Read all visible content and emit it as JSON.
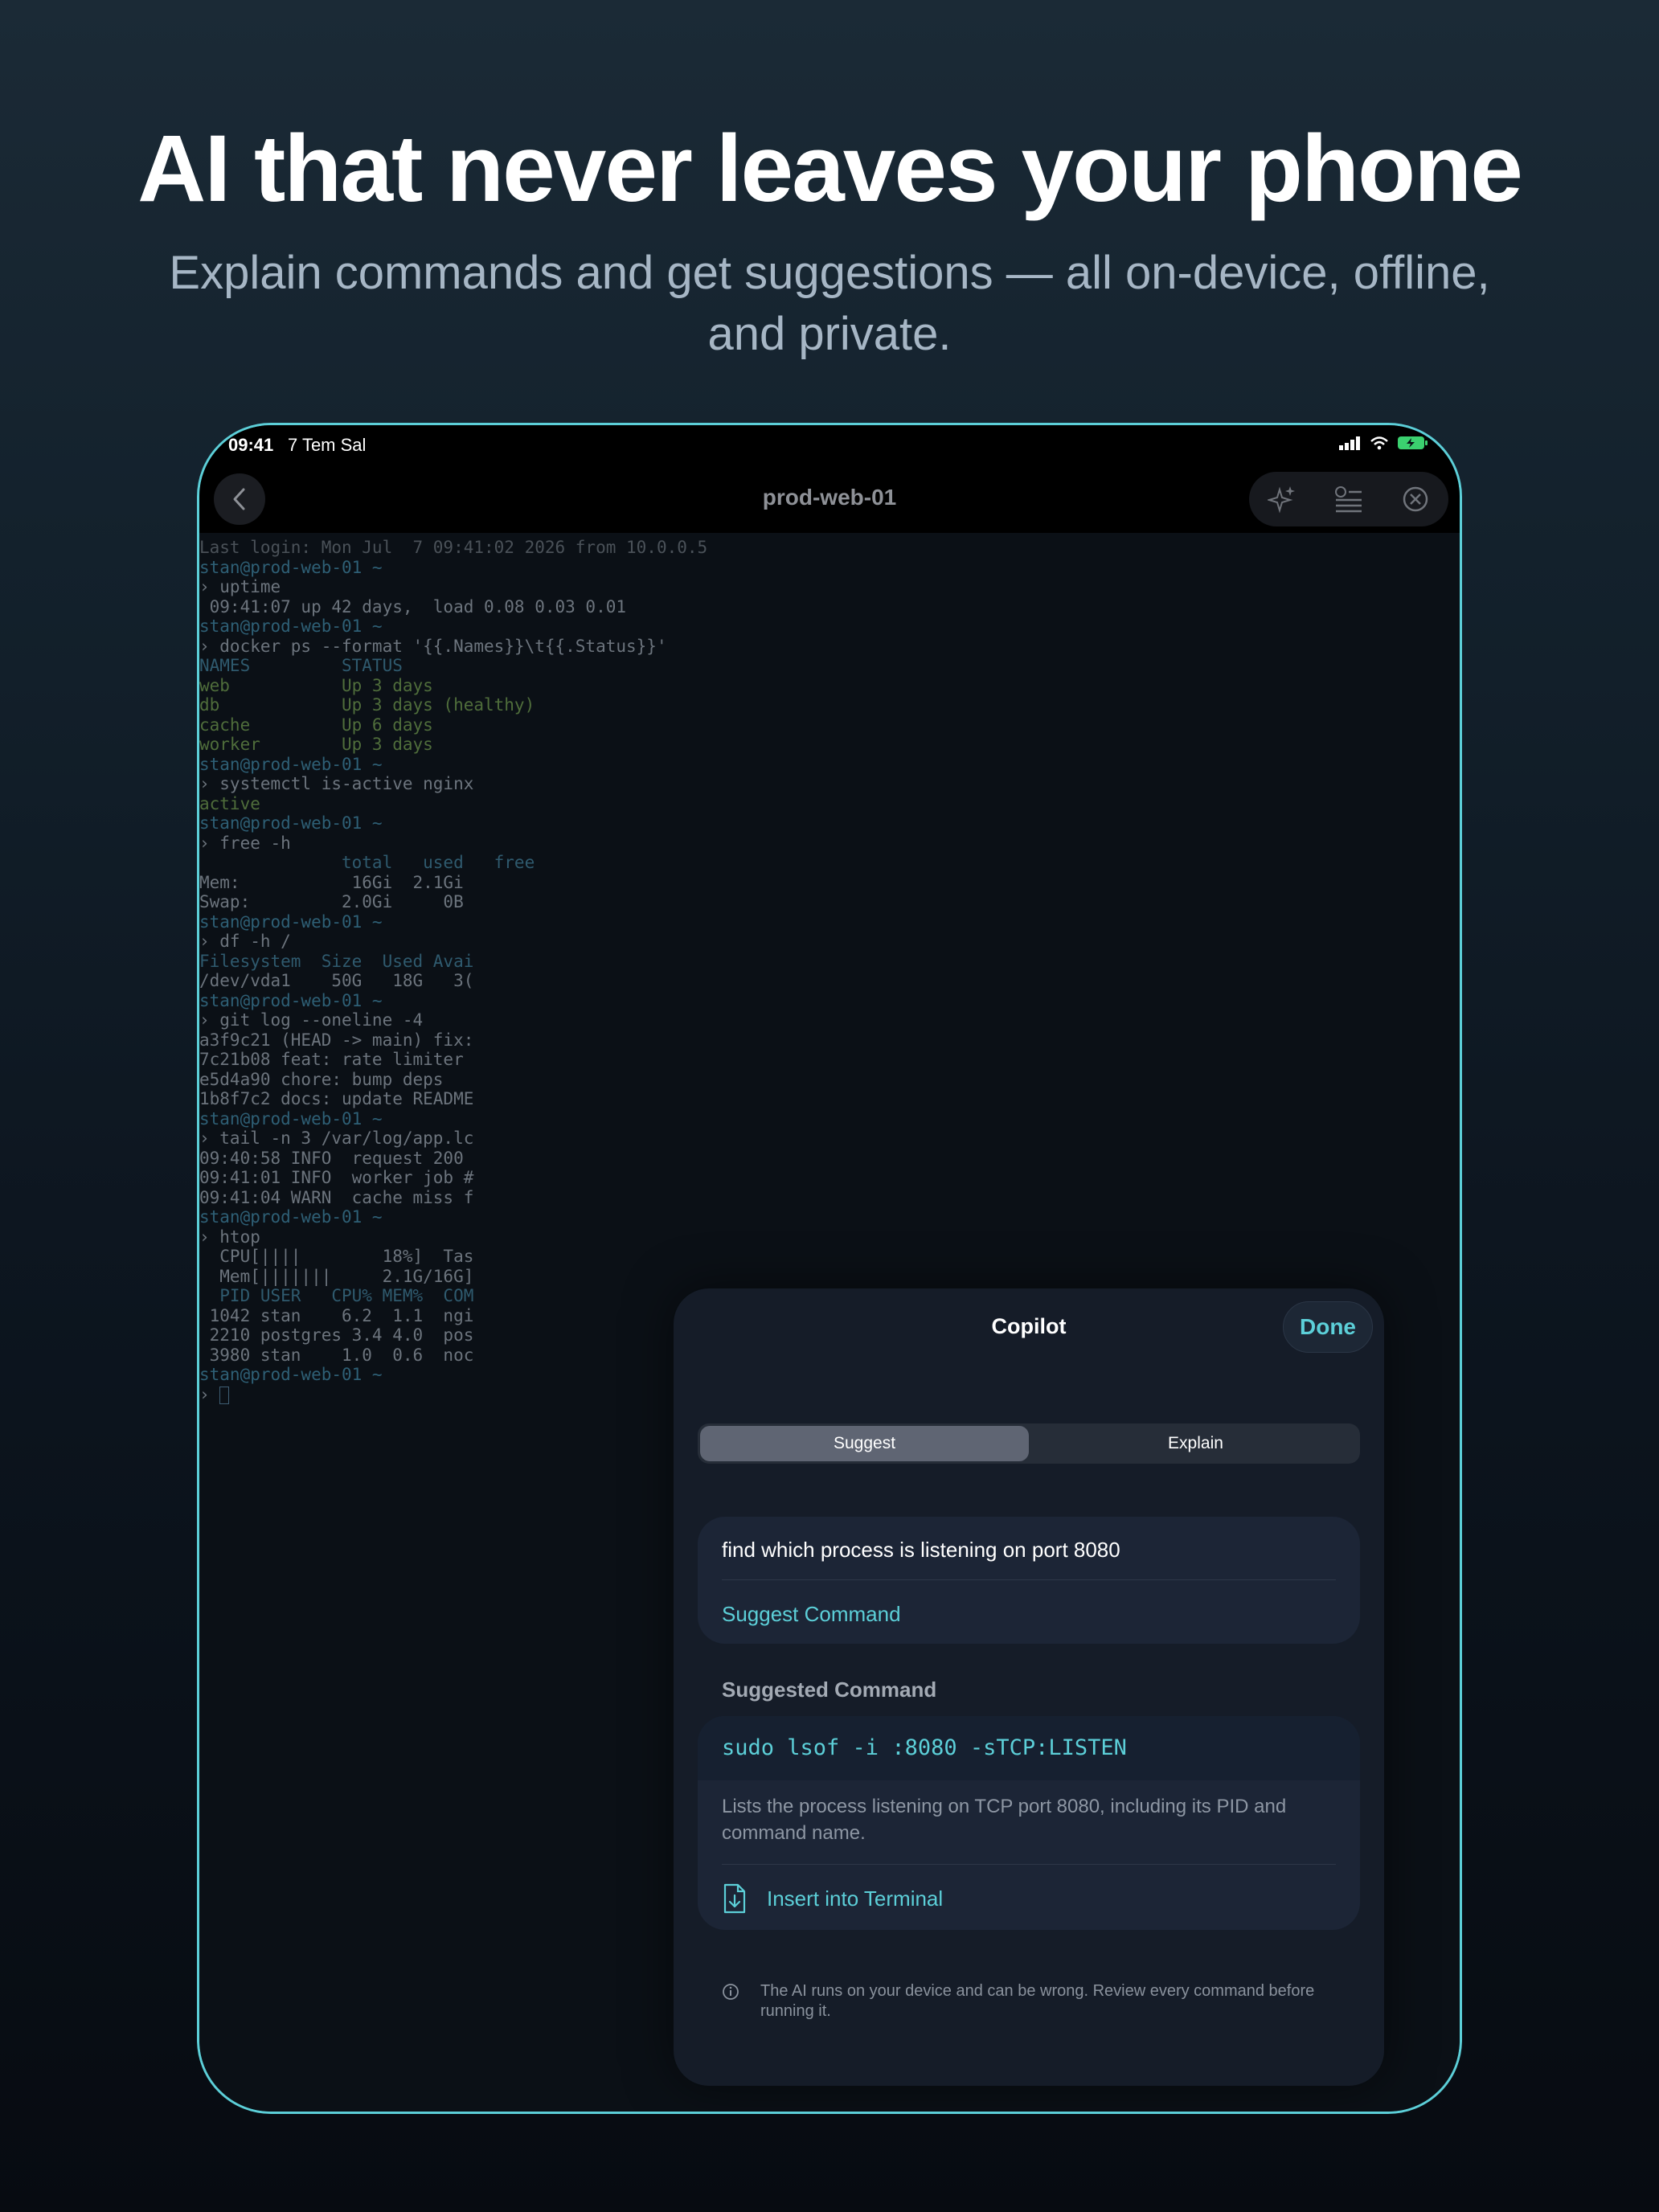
{
  "hero": {
    "title": "AI that never leaves your phone",
    "subtitle": "Explain commands and get suggestions — all on-device, offline, and private."
  },
  "status_bar": {
    "time": "09:41",
    "date": "7 Tem Sal"
  },
  "nav": {
    "title": "prod-web-01"
  },
  "terminal_lines": [
    "Last login: Mon Jul  7 09:41:02 2026 from 10.0.0.5",
    "stan@prod-web-01 ~",
    "› uptime",
    " 09:41:07 up 42 days,  load 0.08 0.03 0.01",
    "stan@prod-web-01 ~",
    "› docker ps --format '{{.Names}}\\t{{.Status}}'",
    "NAMES         STATUS",
    "web           Up 3 days",
    "db            Up 3 days (healthy)",
    "cache         Up 6 days",
    "worker        Up 3 days",
    "stan@prod-web-01 ~",
    "› systemctl is-active nginx",
    "active",
    "stan@prod-web-01 ~",
    "› free -h",
    "              total   used   free",
    "Mem:           16Gi  2.1Gi",
    "Swap:         2.0Gi     0B",
    "stan@prod-web-01 ~",
    "› df -h /",
    "Filesystem  Size  Used Avai",
    "/dev/vda1    50G   18G   3(",
    "stan@prod-web-01 ~",
    "› git log --oneline -4",
    "a3f9c21 (HEAD -> main) fix:",
    "7c21b08 feat: rate limiter",
    "e5d4a90 chore: bump deps",
    "1b8f7c2 docs: update README",
    "stan@prod-web-01 ~",
    "› tail -n 3 /var/log/app.lc",
    "09:40:58 INFO  request 200",
    "09:41:01 INFO  worker job #",
    "09:41:04 WARN  cache miss f",
    "stan@prod-web-01 ~",
    "› htop",
    "  CPU[||||        18%]  Tas",
    "  Mem[|||||||     2.1G/16G]",
    "  PID USER   CPU% MEM%  COM",
    " 1042 stan    6.2  1.1  ngi",
    " 2210 postgres 3.4 4.0  pos",
    " 3980 stan    1.0  0.6  noc",
    "stan@prod-web-01 ~",
    "› "
  ],
  "copilot": {
    "title": "Copilot",
    "done_label": "Done",
    "segments": [
      "Suggest",
      "Explain"
    ],
    "active_segment": "Suggest",
    "input_value": "find which process is listening on port 8080",
    "suggest_button": "Suggest Command",
    "section_label": "Suggested Command",
    "command": "sudo lsof -i :8080 -sTCP:LISTEN",
    "description": "Lists the process listening on TCP port 8080, including its PID and command name.",
    "insert_label": "Insert into Terminal",
    "disclaimer": "The AI runs on your device and can be wrong. Review every command before running it."
  },
  "colors": {
    "accent": "#5ccfd8",
    "frame": "#5ccfd8",
    "sheet": "#151c28"
  },
  "icons": [
    "back-chevron-icon",
    "sparkles-icon",
    "list-settings-icon",
    "close-circle-icon",
    "signal-icon",
    "wifi-icon",
    "battery-charging-icon",
    "document-download-icon",
    "info-icon"
  ]
}
